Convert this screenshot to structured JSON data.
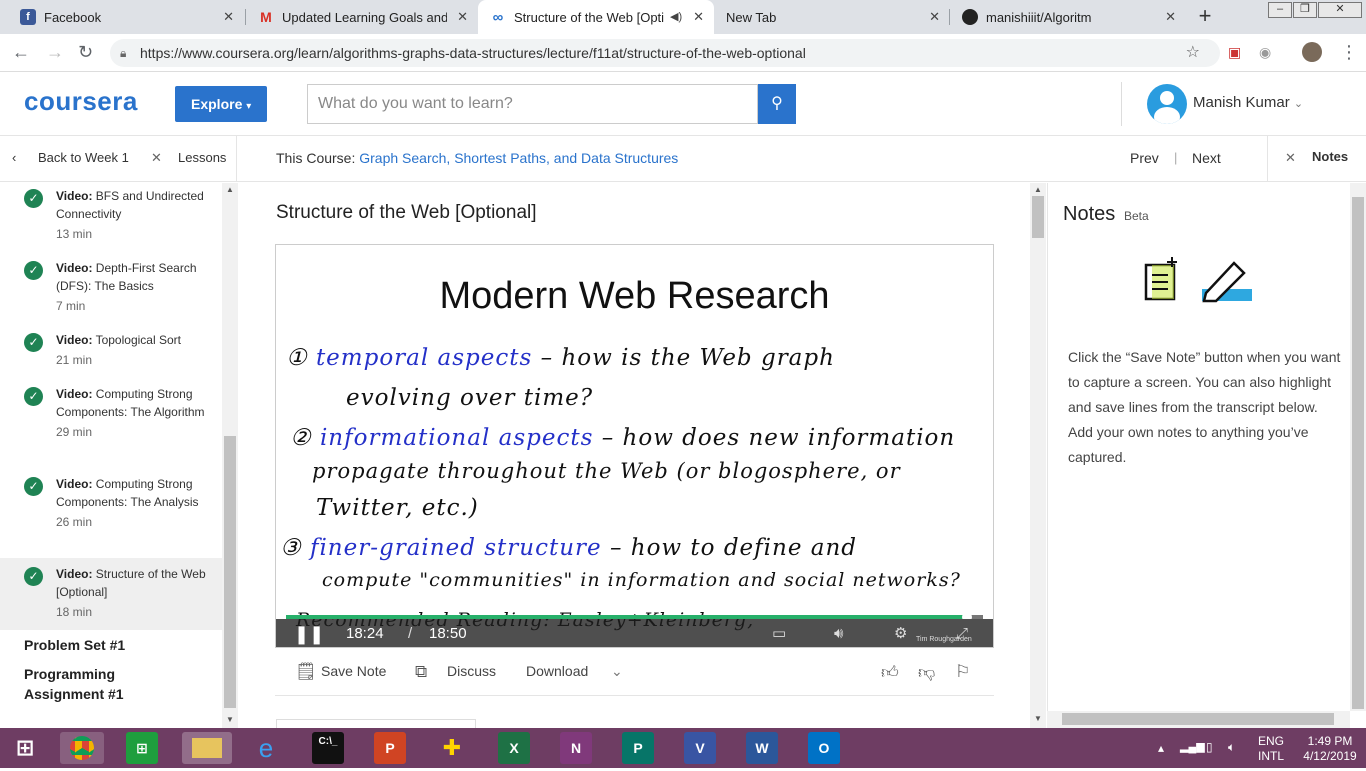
{
  "browser": {
    "tabs": [
      {
        "title": "Facebook",
        "active": false,
        "icon": "facebook-icon",
        "color": "#3b5998",
        "glyph": "f"
      },
      {
        "title": "Updated Learning Goals and Tin",
        "active": false,
        "icon": "gmail-icon",
        "color": "#d93025",
        "glyph": "M"
      },
      {
        "title": "Structure of the Web [Optio",
        "active": true,
        "icon": "coursera-tab-icon",
        "color": "#2a73cc",
        "glyph": "∞"
      },
      {
        "title": "New Tab",
        "active": false,
        "icon": "",
        "color": "",
        "glyph": ""
      },
      {
        "title": "manishiiit/Algoritm",
        "active": false,
        "icon": "github-icon",
        "color": "#222222",
        "glyph": "●"
      }
    ],
    "url": "https://www.coursera.org/learn/algorithms-graphs-data-structures/lecture/f11at/structure-of-the-web-optional"
  },
  "header": {
    "logo": "coursera",
    "explore_label": "Explore",
    "search_placeholder": "What do you want to learn?",
    "user_name": "Manish Kumar"
  },
  "subnav": {
    "back_label": "Back to Week 1",
    "lessons_label": "Lessons",
    "course_prefix": "This Course:",
    "course_name": "Graph Search, Shortest Paths, and Data Structures",
    "prev_label": "Prev",
    "next_label": "Next",
    "notes_label": "Notes"
  },
  "sidebar": {
    "items": [
      {
        "type": "Video:",
        "title": "BFS and Undirected Connectivity",
        "duration": "13 min",
        "active": false
      },
      {
        "type": "Video:",
        "title": "Depth-First Search (DFS): The Basics",
        "duration": "7 min",
        "active": false
      },
      {
        "type": "Video:",
        "title": "Topological Sort",
        "duration": "21 min",
        "active": false
      },
      {
        "type": "Video:",
        "title": "Computing Strong Components: The Algorithm",
        "duration": "29 min",
        "active": false
      },
      {
        "type": "Video:",
        "title": "Computing Strong Components: The Analysis",
        "duration": "26 min",
        "active": false
      },
      {
        "type": "Video:",
        "title": "Structure of the Web [Optional]",
        "duration": "18 min",
        "active": true
      }
    ],
    "sections": [
      "Problem Set #1",
      "Programming Assignment #1"
    ]
  },
  "lecture": {
    "title": "Structure of the Web [Optional]",
    "slide_title": "Modern Web Research",
    "slide_lines": [
      {
        "num": "①",
        "highlight": "temporal aspects",
        "rest": " – how is the Web graph"
      },
      {
        "num": "",
        "highlight": "",
        "rest": "evolving over time?"
      },
      {
        "num": "②",
        "highlight": "informational aspects",
        "rest": " – how does new information"
      },
      {
        "num": "",
        "highlight": "",
        "rest": "propagate throughout the Web (or blogosphere, or"
      },
      {
        "num": "",
        "highlight": "",
        "rest": "Twitter, etc.)"
      },
      {
        "num": "③",
        "highlight": "finer-grained structure",
        "rest": " – how to define and"
      },
      {
        "num": "",
        "highlight": "",
        "rest": "compute \"communities\" in information and social networks?"
      }
    ],
    "slide_footer": "Recommended Reading: Easley+Kleinberg,",
    "slide_credit": "Tim Roughgarden",
    "time_current": "18:24",
    "time_separator": "/",
    "time_total": "18:50",
    "progress": 0.977
  },
  "actions": {
    "save_note": "Save Note",
    "discuss": "Discuss",
    "download": "Download"
  },
  "notes": {
    "title": "Notes",
    "badge": "Beta",
    "instructions": "Click the “Save Note” button when you want to capture a screen. You can also highlight and save lines from the transcript below. Add your own notes to anything you’ve captured."
  },
  "taskbar": {
    "lang_top": "ENG",
    "lang_bottom": "INTL",
    "time": "1:49 PM",
    "date": "4/12/2019"
  }
}
